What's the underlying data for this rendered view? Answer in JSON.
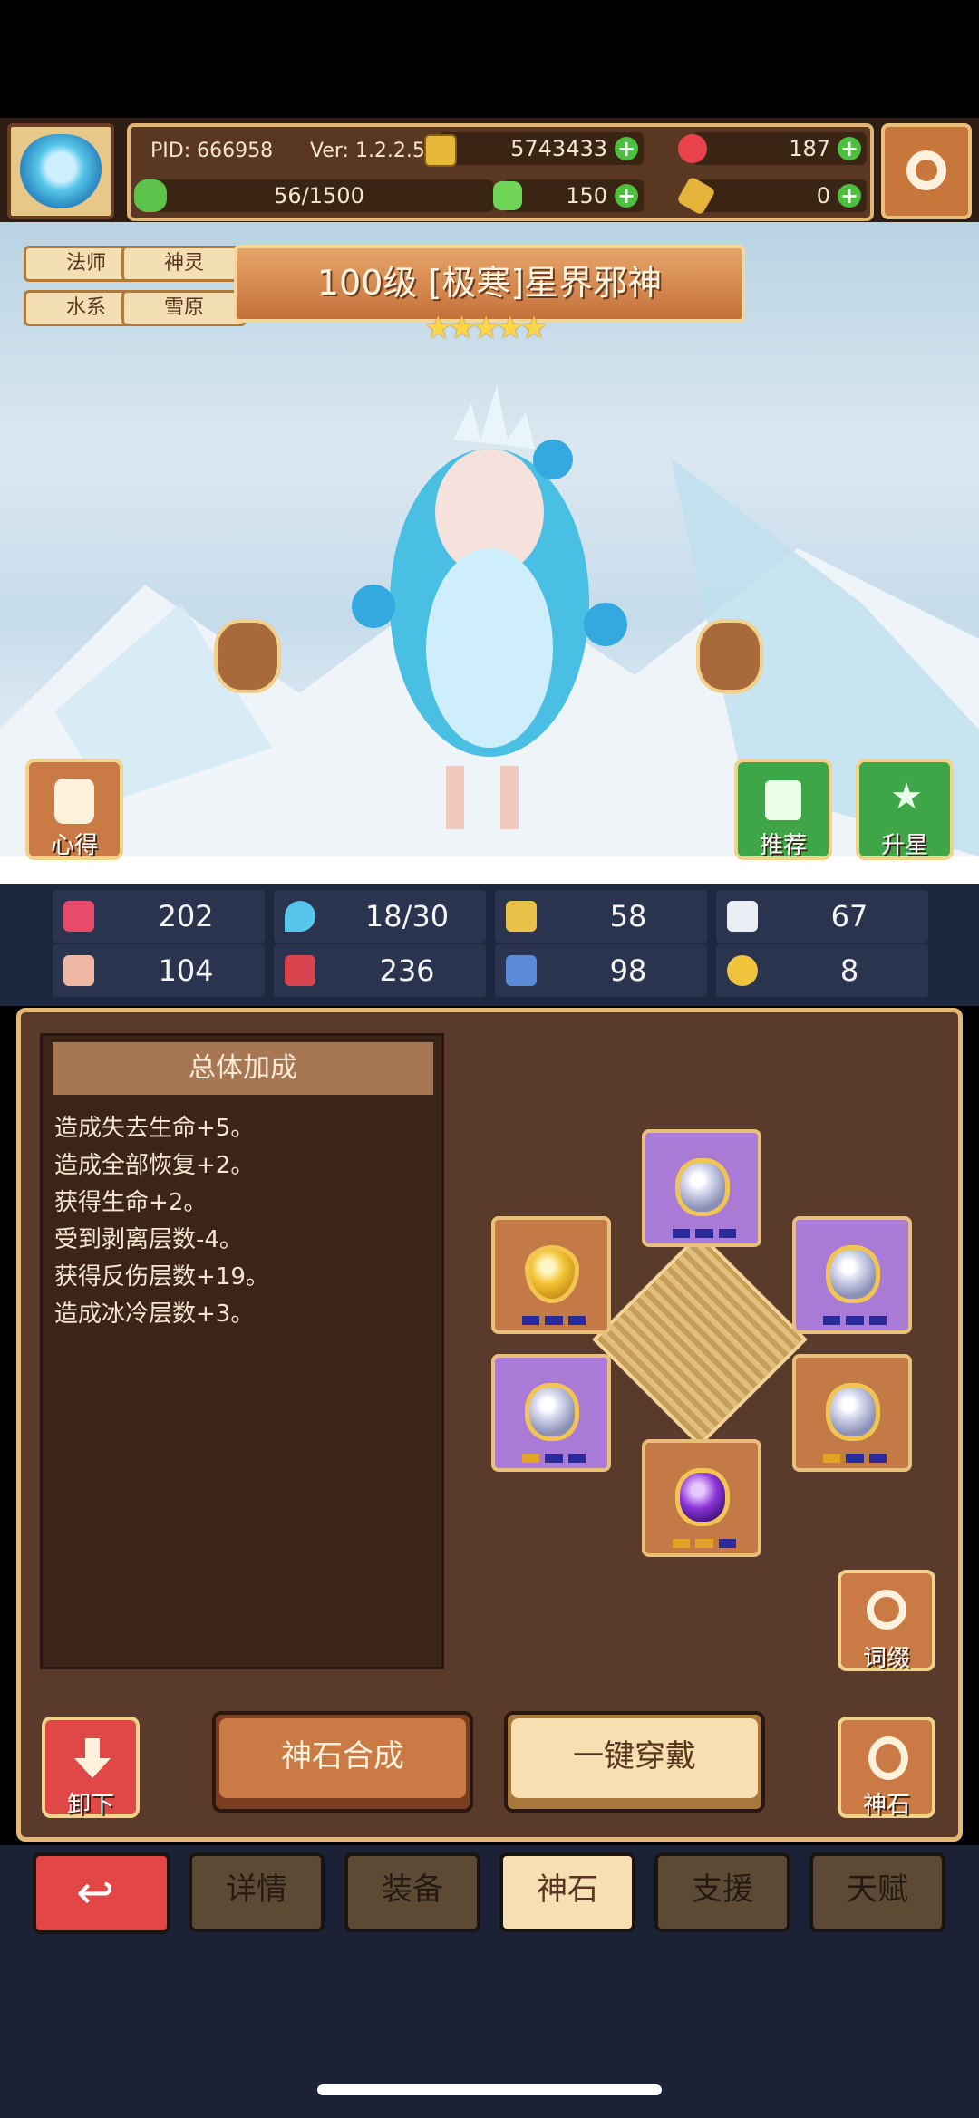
{
  "header": {
    "pid": "PID: 666958",
    "version": "Ver: 1.2.2.5",
    "gold": "5743433",
    "gems": "187",
    "clover": "150",
    "keys": "0",
    "stamina": "56/1500"
  },
  "hero": {
    "tags": [
      "法师",
      "神灵",
      "水系",
      "雪原"
    ],
    "title": "100级 [极寒]星界邪神",
    "stars": "★★★★★",
    "left_button": "心得",
    "recommend_button": "推荐",
    "upgrade_button": "升星"
  },
  "stats": [
    {
      "icon": "heart-icon",
      "value": "202"
    },
    {
      "icon": "water-drop-icon",
      "value": "18/30"
    },
    {
      "icon": "shield-icon",
      "value": "58"
    },
    {
      "icon": "wing-icon",
      "value": "67"
    },
    {
      "icon": "fist-icon",
      "value": "104"
    },
    {
      "icon": "book-icon",
      "value": "236"
    },
    {
      "icon": "boot-icon",
      "value": "98"
    },
    {
      "icon": "horseshoe-icon",
      "value": "8"
    }
  ],
  "bonus": {
    "title": "总体加成",
    "lines": [
      "造成失去生命+5。",
      "造成全部恢复+2。",
      "获得生命+2。",
      "受到剥离层数-4。",
      "获得反伤层数+19。",
      "造成冰冷层数+3。"
    ]
  },
  "actions": {
    "unequip": "卸下",
    "synthesize": "神石合成",
    "equip_all": "一键穿戴",
    "affix": "词缀",
    "godstone": "神石"
  },
  "nav": {
    "tabs": [
      "详情",
      "装备",
      "神石",
      "支援",
      "天赋"
    ],
    "active": "神石"
  },
  "colors": {
    "panel_brown": "#5a3b2b",
    "gold_border": "#e7b776",
    "stat_bg": "#2a344f",
    "purple_slot": "#a97ad6",
    "orange_slot": "#c47a47"
  }
}
